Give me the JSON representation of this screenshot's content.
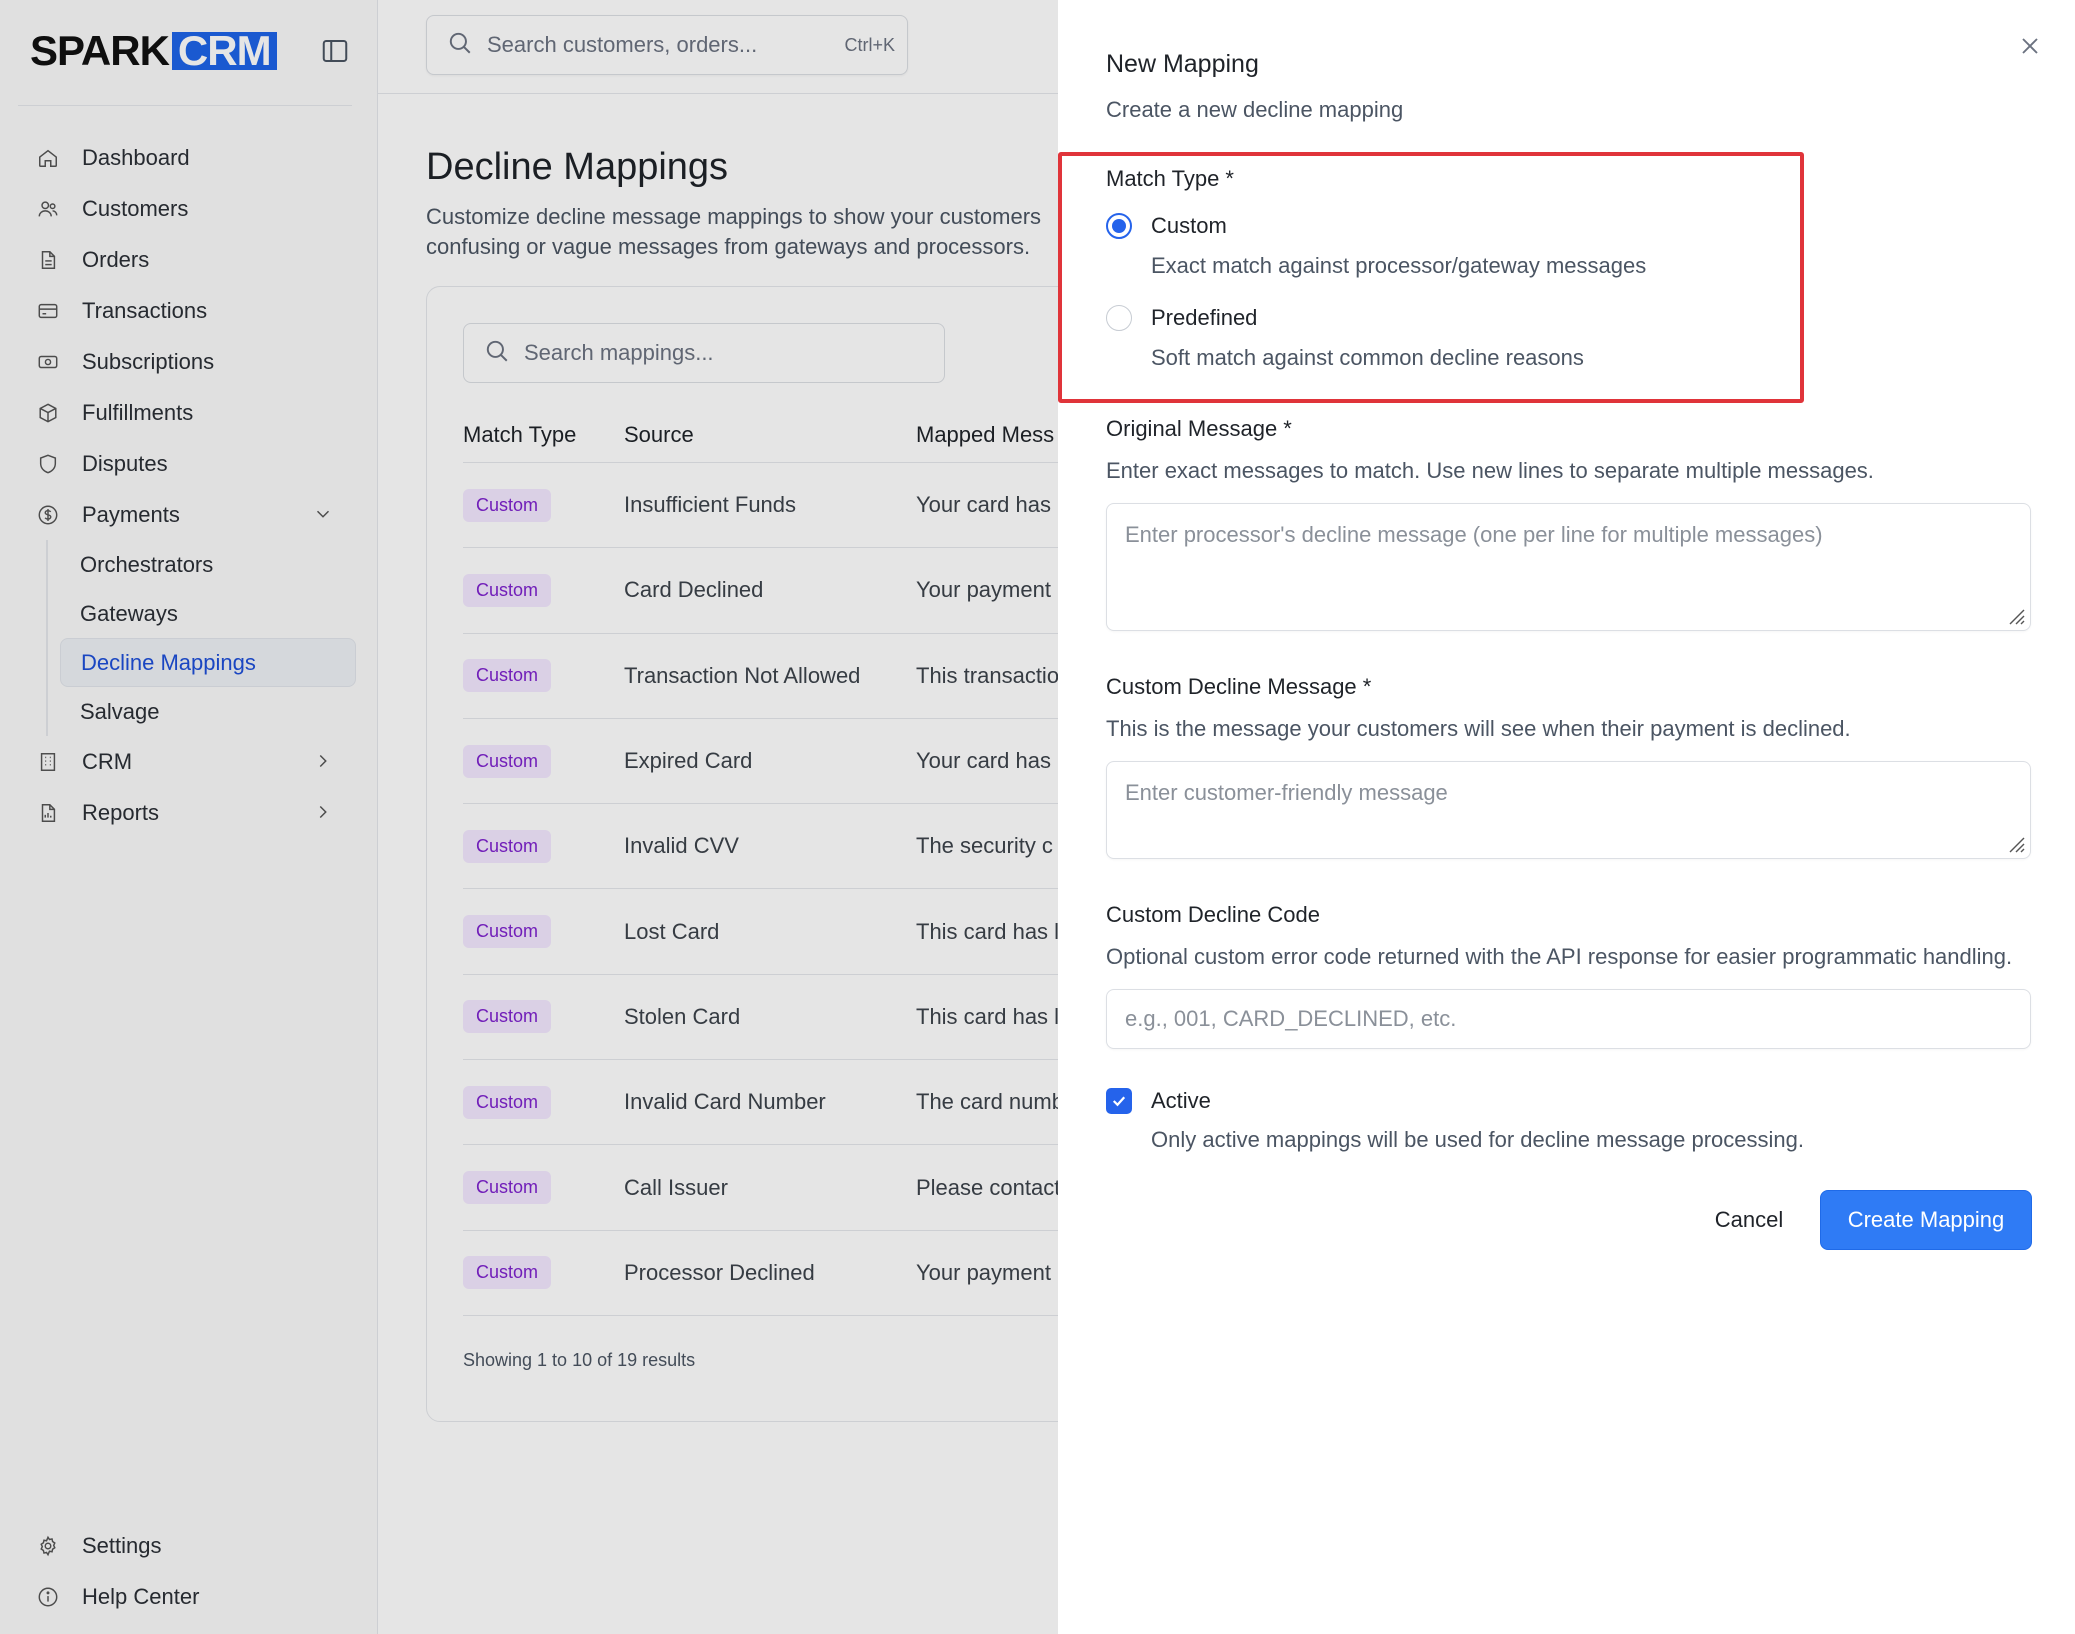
{
  "brand": {
    "name_part1": "SPARK",
    "name_part2": "CRM",
    "accent": "#1d64e8"
  },
  "topbar": {
    "search_placeholder": "Search customers, orders...",
    "shortcut": "Ctrl+K"
  },
  "sidebar": {
    "items": [
      {
        "label": "Dashboard",
        "icon": "home-icon"
      },
      {
        "label": "Customers",
        "icon": "users-icon"
      },
      {
        "label": "Orders",
        "icon": "file-icon"
      },
      {
        "label": "Transactions",
        "icon": "credit-card-icon"
      },
      {
        "label": "Subscriptions",
        "icon": "banknote-icon"
      },
      {
        "label": "Fulfillments",
        "icon": "package-icon"
      },
      {
        "label": "Disputes",
        "icon": "shield-icon"
      },
      {
        "label": "Payments",
        "icon": "dollar-circle-icon"
      }
    ],
    "payments_sub": [
      {
        "label": "Orchestrators"
      },
      {
        "label": "Gateways"
      },
      {
        "label": "Decline Mappings",
        "active": true
      },
      {
        "label": "Salvage"
      }
    ],
    "after": [
      {
        "label": "CRM",
        "icon": "building-icon"
      },
      {
        "label": "Reports",
        "icon": "report-icon"
      }
    ],
    "bottom": [
      {
        "label": "Settings",
        "icon": "gear-icon"
      },
      {
        "label": "Help Center",
        "icon": "info-icon"
      }
    ]
  },
  "page": {
    "title": "Decline Mappings",
    "description": "Customize decline message mappings to show your customers confusing or vague messages from gateways and processors."
  },
  "table": {
    "search_placeholder": "Search mappings...",
    "columns": [
      "Match Type",
      "Source",
      "Mapped Mess"
    ],
    "rows": [
      {
        "type": "Custom",
        "source": "Insufficient Funds",
        "mapped": "Your card has"
      },
      {
        "type": "Custom",
        "source": "Card Declined",
        "mapped": "Your payment"
      },
      {
        "type": "Custom",
        "source": "Transaction Not Allowed",
        "mapped": "This transactio"
      },
      {
        "type": "Custom",
        "source": "Expired Card",
        "mapped": "Your card has"
      },
      {
        "type": "Custom",
        "source": "Invalid CVV",
        "mapped": "The security c"
      },
      {
        "type": "Custom",
        "source": "Lost Card",
        "mapped": "This card has l"
      },
      {
        "type": "Custom",
        "source": "Stolen Card",
        "mapped": "This card has l"
      },
      {
        "type": "Custom",
        "source": "Invalid Card Number",
        "mapped": "The card numb"
      },
      {
        "type": "Custom",
        "source": "Call Issuer",
        "mapped": "Please contact"
      },
      {
        "type": "Custom",
        "source": "Processor Declined",
        "mapped": "Your payment"
      }
    ],
    "footer": "Showing 1 to 10 of 19 results"
  },
  "panel": {
    "title": "New Mapping",
    "subtitle": "Create a new decline mapping",
    "match_type": {
      "label": "Match Type *",
      "options": [
        {
          "label": "Custom",
          "description": "Exact match against processor/gateway messages",
          "selected": true
        },
        {
          "label": "Predefined",
          "description": "Soft match against common decline reasons",
          "selected": false
        }
      ]
    },
    "original_message": {
      "label": "Original Message *",
      "help": "Enter exact messages to match. Use new lines to separate multiple messages.",
      "placeholder": "Enter processor's decline message (one per line for multiple messages)"
    },
    "custom_message": {
      "label": "Custom Decline Message *",
      "help": "This is the message your customers will see when their payment is declined.",
      "placeholder": "Enter customer-friendly message"
    },
    "custom_code": {
      "label": "Custom Decline Code",
      "help": "Optional custom error code returned with the API response for easier programmatic handling.",
      "placeholder": "e.g., 001, CARD_DECLINED, etc."
    },
    "active": {
      "label": "Active",
      "help": "Only active mappings will be used for decline message processing.",
      "checked": true
    },
    "buttons": {
      "cancel": "Cancel",
      "create": "Create Mapping"
    },
    "highlight_color": "#e0343a",
    "primary_color": "#2f7bf5"
  }
}
